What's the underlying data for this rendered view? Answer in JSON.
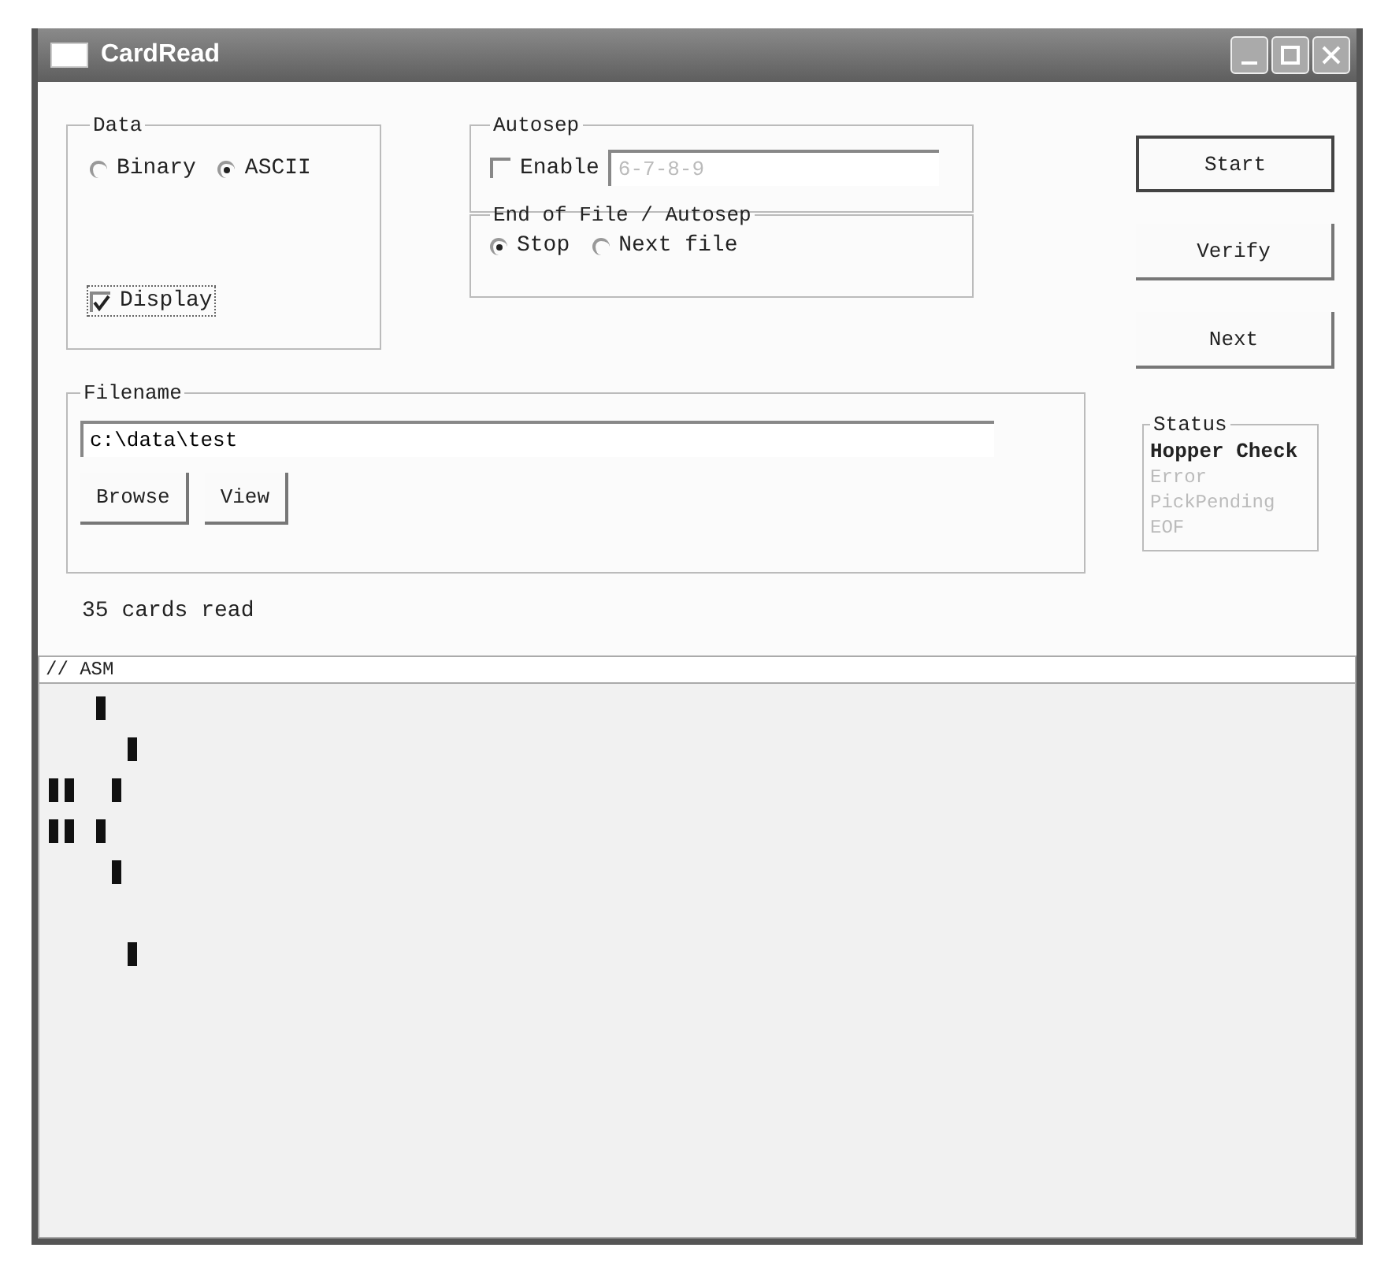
{
  "window": {
    "title": "CardRead"
  },
  "data_group": {
    "title": "Data",
    "radios": [
      {
        "label": "Binary",
        "selected": false
      },
      {
        "label": "ASCII",
        "selected": true
      }
    ],
    "display": {
      "label": "Display",
      "checked": true
    }
  },
  "autosep_group": {
    "title": "Autosep",
    "enable": {
      "label": "Enable",
      "checked": false
    },
    "value": "6-7-8-9"
  },
  "eof_group": {
    "title": "End of File / Autosep",
    "radios": [
      {
        "label": "Stop",
        "selected": true
      },
      {
        "label": "Next file",
        "selected": false
      }
    ]
  },
  "buttons": [
    "Start",
    "Verify",
    "Next"
  ],
  "filename_group": {
    "title": "Filename",
    "value": "c:\\data\\test",
    "buttons": [
      "Browse",
      "View"
    ]
  },
  "cards_read": "35 cards read",
  "status_group": {
    "title": "Status",
    "items": [
      {
        "label": "Hopper Check",
        "active": true
      },
      {
        "label": "Error",
        "active": false
      },
      {
        "label": "PickPending",
        "active": false
      },
      {
        "label": "EOF",
        "active": false
      }
    ]
  },
  "card_display": {
    "header": "// ASM",
    "rows": [
      [
        false,
        false,
        false,
        true,
        false,
        false
      ],
      [
        false,
        false,
        false,
        false,
        false,
        true
      ],
      [
        true,
        true,
        false,
        false,
        true,
        false
      ],
      [
        true,
        true,
        false,
        true,
        false,
        false
      ],
      [
        false,
        false,
        false,
        false,
        true,
        false
      ],
      [
        false,
        false,
        false,
        false,
        false,
        false
      ],
      [
        false,
        false,
        false,
        false,
        false,
        true
      ]
    ]
  }
}
